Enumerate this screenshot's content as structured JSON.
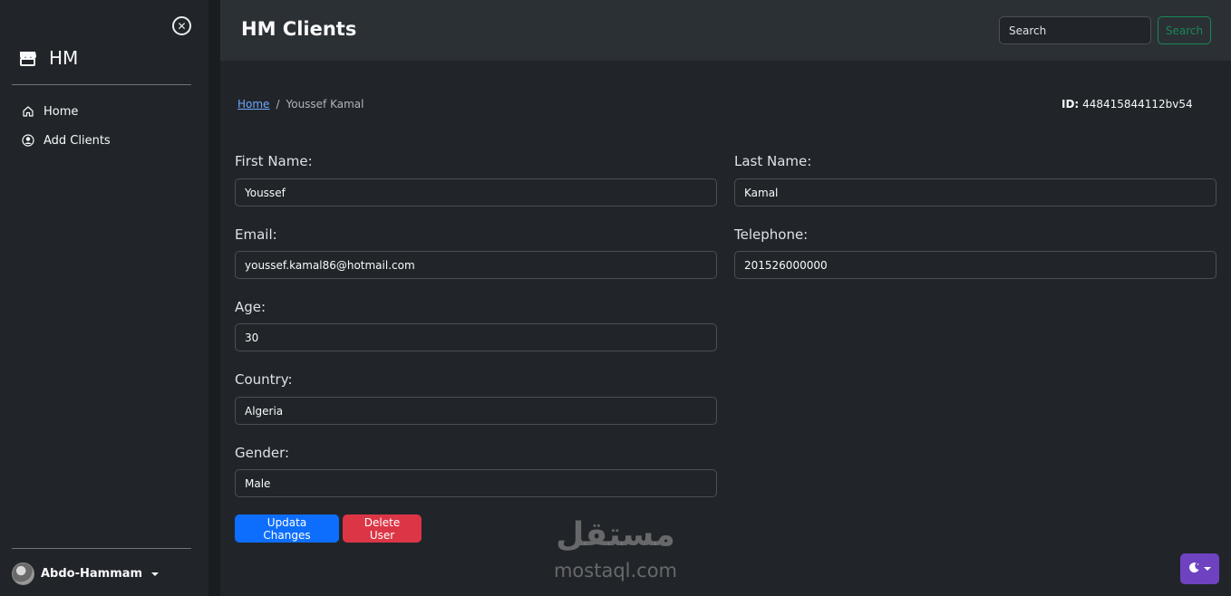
{
  "sidebar": {
    "brand": "HM",
    "items": [
      {
        "label": "Home",
        "icon": "home-icon"
      },
      {
        "label": "Add Clients",
        "icon": "user-circle-icon"
      }
    ],
    "user": {
      "name": "Abdo-Hammam"
    }
  },
  "header": {
    "title": "HM Clients",
    "search_placeholder": "Search",
    "search_button": "Search"
  },
  "breadcrumb": {
    "home": "Home",
    "separator": "/",
    "current": "Youssef Kamal"
  },
  "record": {
    "id_label": "ID:",
    "id_value": "448415844112bv54"
  },
  "form": {
    "first_name": {
      "label": "First Name:",
      "value": "Youssef"
    },
    "last_name": {
      "label": "Last Name:",
      "value": "Kamal"
    },
    "email": {
      "label": "Email:",
      "value": "youssef.kamal86@hotmail.com"
    },
    "telephone": {
      "label": "Telephone:",
      "value": "201526000000"
    },
    "age": {
      "label": "Age:",
      "value": "30"
    },
    "country": {
      "label": "Country:",
      "value": "Algeria"
    },
    "gender": {
      "label": "Gender:",
      "value": "Male"
    }
  },
  "actions": {
    "update": "Updata Changes",
    "delete": "Delete User"
  },
  "watermark": {
    "arabic": "مستقل",
    "latin": "mostaql.com"
  },
  "colors": {
    "primary": "#0d6efd",
    "danger": "#dc3545",
    "success": "#198754",
    "theme_toggle": "#6f42c1",
    "background": "#212529",
    "header": "#2b3035"
  }
}
